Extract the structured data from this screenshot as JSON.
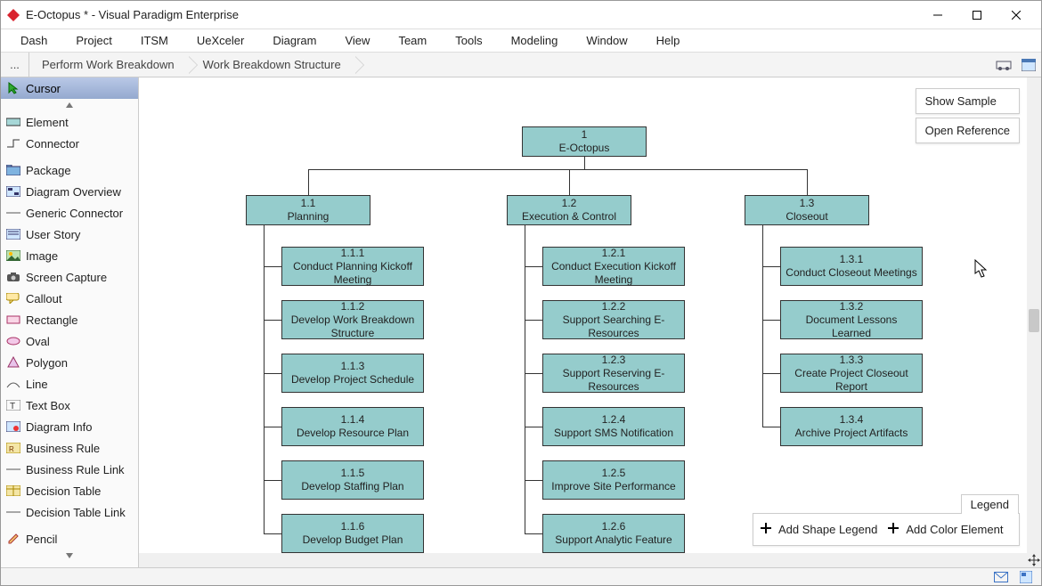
{
  "window": {
    "title": "E-Octopus * - Visual Paradigm Enterprise"
  },
  "menubar": {
    "items": [
      "Dash",
      "Project",
      "ITSM",
      "UeXceler",
      "Diagram",
      "View",
      "Team",
      "Tools",
      "Modeling",
      "Window",
      "Help"
    ]
  },
  "breadcrumb": {
    "root": "...",
    "items": [
      "Perform Work Breakdown",
      "Work Breakdown Structure"
    ]
  },
  "palette": {
    "active": "Cursor",
    "items": [
      {
        "name": "Cursor",
        "icon": "cursor"
      },
      {
        "name": "Element",
        "icon": "element"
      },
      {
        "name": "Connector",
        "icon": "connector"
      },
      {
        "name": "Package",
        "icon": "package"
      },
      {
        "name": "Diagram Overview",
        "icon": "overview"
      },
      {
        "name": "Generic Connector",
        "icon": "generic-connector"
      },
      {
        "name": "User Story",
        "icon": "userstory"
      },
      {
        "name": "Image",
        "icon": "image"
      },
      {
        "name": "Screen Capture",
        "icon": "screencap"
      },
      {
        "name": "Callout",
        "icon": "callout"
      },
      {
        "name": "Rectangle",
        "icon": "rect"
      },
      {
        "name": "Oval",
        "icon": "oval"
      },
      {
        "name": "Polygon",
        "icon": "polygon"
      },
      {
        "name": "Line",
        "icon": "line"
      },
      {
        "name": "Text Box",
        "icon": "textbox"
      },
      {
        "name": "Diagram Info",
        "icon": "diagraminfo"
      },
      {
        "name": "Business Rule",
        "icon": "br"
      },
      {
        "name": "Business Rule Link",
        "icon": "brl"
      },
      {
        "name": "Decision Table",
        "icon": "dt"
      },
      {
        "name": "Decision Table Link",
        "icon": "dtl"
      },
      {
        "name": "Pencil",
        "icon": "pencil"
      }
    ]
  },
  "canvas_buttons": {
    "show_sample": "Show Sample",
    "open_reference": "Open Reference"
  },
  "legend": {
    "title": "Legend",
    "add_shape": "Add Shape Legend",
    "add_color": "Add Color Element"
  },
  "chart_data": {
    "type": "wbs-tree",
    "title": "Work Breakdown Structure",
    "root": {
      "id": "1",
      "label": "E-Octopus"
    },
    "branches": [
      {
        "id": "1.1",
        "label": "Planning",
        "children": [
          {
            "id": "1.1.1",
            "label": "Conduct Planning Kickoff Meeting"
          },
          {
            "id": "1.1.2",
            "label": "Develop Work Breakdown Structure"
          },
          {
            "id": "1.1.3",
            "label": "Develop Project Schedule"
          },
          {
            "id": "1.1.4",
            "label": "Develop Resource Plan"
          },
          {
            "id": "1.1.5",
            "label": "Develop Staffing Plan"
          },
          {
            "id": "1.1.6",
            "label": "Develop Budget Plan"
          }
        ]
      },
      {
        "id": "1.2",
        "label": "Execution & Control",
        "children": [
          {
            "id": "1.2.1",
            "label": "Conduct Execution Kickoff Meeting"
          },
          {
            "id": "1.2.2",
            "label": "Support Searching E-Resources"
          },
          {
            "id": "1.2.3",
            "label": "Support Reserving E-Resources"
          },
          {
            "id": "1.2.4",
            "label": "Support SMS Notification"
          },
          {
            "id": "1.2.5",
            "label": "Improve Site Performance"
          },
          {
            "id": "1.2.6",
            "label": "Support Analytic Feature"
          }
        ]
      },
      {
        "id": "1.3",
        "label": "Closeout",
        "children": [
          {
            "id": "1.3.1",
            "label": "Conduct Closeout Meetings"
          },
          {
            "id": "1.3.2",
            "label": "Document Lessons Learned"
          },
          {
            "id": "1.3.3",
            "label": "Create Project Closeout Report"
          },
          {
            "id": "1.3.4",
            "label": "Archive Project Artifacts"
          }
        ]
      }
    ],
    "node_color": "#95cccc"
  }
}
